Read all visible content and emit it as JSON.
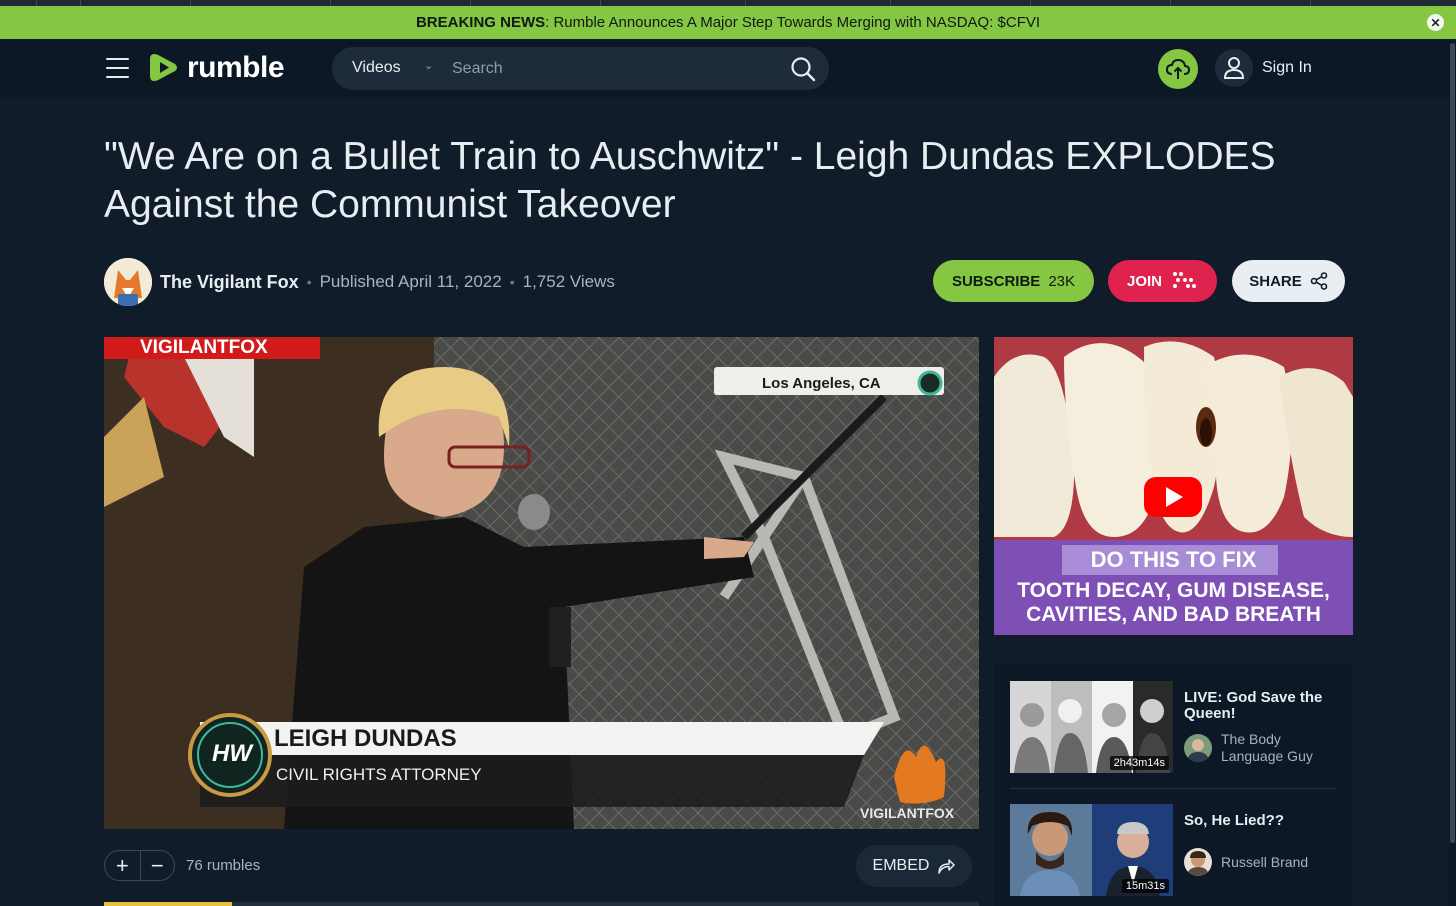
{
  "banner": {
    "label": "BREAKING NEWS",
    "text": ": Rumble Announces A Major Step Towards Merging with NASDAQ: $CFVI",
    "close_glyph": "✕"
  },
  "header": {
    "logo_text": "rumble",
    "search": {
      "category": "Videos",
      "placeholder": "Search"
    },
    "sign_in_label": "Sign In"
  },
  "video": {
    "title": "\"We Are on a Bullet Train to Auschwitz\" - Leigh Dundas EXPLODES Against the Communist Takeover",
    "channel_name": "The Vigilant Fox",
    "published": "Published April 11, 2022",
    "views": "1,752 Views",
    "overlay": {
      "brand_tag": "VIGILANTFOX",
      "location": "Los Angeles, CA",
      "lower_third_name": "LEIGH DUNDAS",
      "lower_third_role": "CIVIL RIGHTS ATTORNEY",
      "badge": "HW",
      "watermark": "VIGILANTFOX"
    }
  },
  "actions": {
    "subscribe_label": "SUBSCRIBE",
    "subscribe_count": "23K",
    "join_label": "JOIN",
    "share_label": "SHARE",
    "rumbles_count": "76 rumbles",
    "embed_label": "EMBED"
  },
  "ad": {
    "line1": "DO THIS TO FIX",
    "line2": "TOOTH DECAY, GUM DISEASE,",
    "line3": "CAVITIES, AND BAD BREATH"
  },
  "related": [
    {
      "title": "LIVE: God Save the Queen!",
      "channel": "The Body Language Guy",
      "duration": "2h43m14s"
    },
    {
      "title": "So, He Lied??",
      "channel": "Russell Brand",
      "duration": "15m31s"
    }
  ],
  "colors": {
    "accent": "#85c742",
    "join": "#e0234e",
    "background": "#101c2a"
  }
}
